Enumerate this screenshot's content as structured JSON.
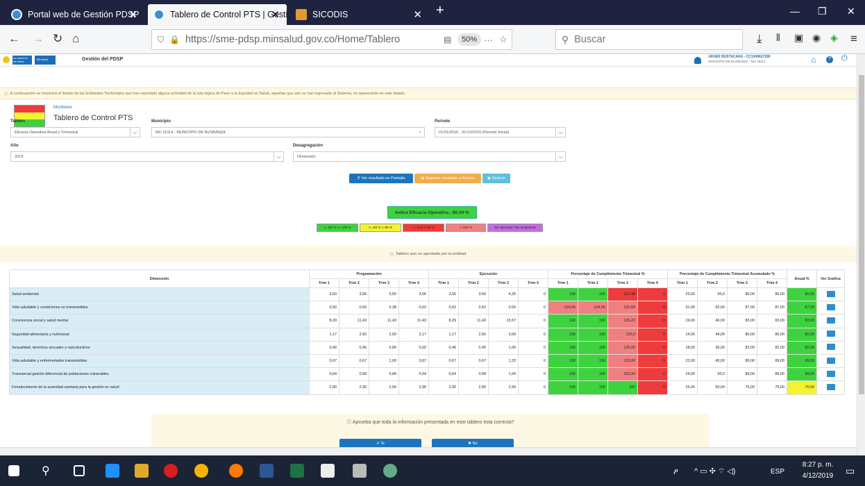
{
  "browser": {
    "tabs": [
      {
        "title": "Portal web de Gestión PDSP"
      },
      {
        "title": "Tablero de Control PTS | Gestió"
      },
      {
        "title": "SICODIS"
      }
    ],
    "url": "https://sme-pdsp.minsalud.gov.co/Home/Tablero",
    "zoom": "50%",
    "search_placeholder": "Buscar"
  },
  "app": {
    "logo_text": "La salud es de todos",
    "logo_badge": "Minsalud",
    "title": "Gestión del PDSP",
    "user": "JAVIER BUSTACARA - CC1049627289",
    "user_sub": "MUNICIPIO DE BUSBANZA - MU 15114",
    "alert": "A continuación se mostrará el listado de las Entidades Territoriales que han reportado alguna actividad de la ruta lógica de Paso a la Equidad en Salud, aquellas que aún no han ingresado al Sistema, no aparecerán en este listado.",
    "breadcrumb": "Monitoreo",
    "page_title": "Tablero de Control PTS"
  },
  "filters": {
    "tablero_label": "Tablero",
    "tablero_value": "Eficacia Operativa Anual y Trimestral",
    "municipio_label": "Municipio",
    "municipio_value": "MU 15114 - MUNICIPIO DE BUSBANZA",
    "periodo_label": "Periodo",
    "periodo_value": "01/01/2016 - 31/12/2019 (Periodo Inicial)",
    "anio_label": "Año",
    "anio_value": "2019",
    "desagregacion_label": "Desagregación",
    "desagregacion_value": "Dimensión"
  },
  "buttons": {
    "ver": "Ver resultado en Pantalla",
    "exportar": "Exportar resultado a Archivo",
    "reducir": "Reducir"
  },
  "indice": "Indice Eficacia Operativa : 80,04 %",
  "legend": [
    {
      "label": ">= 80 % <= 100 %",
      "color": "#3ed33e"
    },
    {
      "label": ">= 60 % < 80 %",
      "color": "#f3f335"
    },
    {
      "label": ">= 0 % < 60 %",
      "color": "#ee3b3b"
    },
    {
      "label": "> 100 %",
      "color": "#f08080"
    },
    {
      "label": "Sin ejecutar / Sin programar",
      "color": "#c36ce0"
    }
  ],
  "notice": "Tablero aun no aprobado por la entidad.",
  "table": {
    "h_dimension": "Dimensión",
    "h_prog": "Programación",
    "h_ejec": "Ejecución",
    "h_pct": "Porcentaje de Cumplimiento Trimestral %",
    "h_acum": "Porcentaje de Cumplimiento Trimestral Acumulado %",
    "h_anual": "Anual %",
    "h_graf": "Ver Grafica",
    "trims": [
      "Trim 1",
      "Trim 2",
      "Trim 3",
      "Trim 4"
    ],
    "rows": [
      {
        "name": "Salud ambiental",
        "prog": [
          "3,50",
          "3,56",
          "3,50",
          "3,56"
        ],
        "ejec": [
          "3,50",
          "3,56",
          "4,25",
          "0"
        ],
        "pct": [
          "100",
          "100",
          "121,43",
          "0"
        ],
        "pc": [
          "g",
          "g",
          "r",
          "r"
        ],
        "acum": [
          "25,00",
          "50,0",
          "80,00",
          "80,00"
        ],
        "anual": "80,00",
        "ac": "g"
      },
      {
        "name": "Vida saludable y condiciones no transmisibles",
        "prog": [
          "0,50",
          "0,50",
          "0,38",
          "0,62"
        ],
        "ejec": [
          "0,62",
          "0,62",
          "0,50",
          "0"
        ],
        "pct": [
          "124,00",
          "124,00",
          "131,58",
          "0"
        ],
        "pc": [
          "p",
          "p",
          "p",
          "r"
        ],
        "acum": [
          "31,00",
          "62,00",
          "87,00",
          "87,00"
        ],
        "anual": "87,00",
        "ac": "g"
      },
      {
        "name": "Convivencia social y salud mental",
        "prog": [
          "8,29",
          "11,43",
          "11,43",
          "11,43"
        ],
        "ejec": [
          "8,29",
          "11,43",
          "15,57",
          "0"
        ],
        "pct": [
          "100",
          "100",
          "136,22",
          "0"
        ],
        "pc": [
          "g",
          "g",
          "p",
          "r"
        ],
        "acum": [
          "19,00",
          "46,00",
          "83,00",
          "83,00"
        ],
        "anual": "83,00",
        "ac": "g"
      },
      {
        "name": "Seguridad alimentaria y nutricional",
        "prog": [
          "1,17",
          "2,50",
          "2,50",
          "2,17"
        ],
        "ejec": [
          "1,17",
          "2,50",
          "3,00",
          "0"
        ],
        "pct": [
          "100",
          "100",
          "120,0",
          "0"
        ],
        "pc": [
          "g",
          "g",
          "p",
          "r"
        ],
        "acum": [
          "14,00",
          "44,00",
          "80,00",
          "80,00"
        ],
        "anual": "80,00",
        "ac": "g"
      },
      {
        "name": "Sexualidad, derechos sexuales y reproductivos",
        "prog": [
          "0,40",
          "0,40",
          "0,80",
          "0,60"
        ],
        "ejec": [
          "0,40",
          "0,40",
          "1,00",
          "0"
        ],
        "pct": [
          "100",
          "100",
          "125,00",
          "0"
        ],
        "pc": [
          "g",
          "g",
          "p",
          "r"
        ],
        "acum": [
          "18,00",
          "36,00",
          "82,00",
          "82,00"
        ],
        "anual": "82,00",
        "ac": "g"
      },
      {
        "name": "Vida saludable y enfermedades transmisibles",
        "prog": [
          "0,67",
          "0,67",
          "1,00",
          "0,67"
        ],
        "ejec": [
          "0,67",
          "0,67",
          "1,33",
          "0"
        ],
        "pct": [
          "100",
          "100",
          "133,00",
          "0"
        ],
        "pc": [
          "g",
          "g",
          "p",
          "r"
        ],
        "acum": [
          "22,00",
          "45,00",
          "89,00",
          "89,00"
        ],
        "anual": "89,00",
        "ac": "g"
      },
      {
        "name": "Transversal gestión diferencial de poblaciones vulnerables",
        "prog": [
          "0,64",
          "0,68",
          "0,68",
          "0,64"
        ],
        "ejec": [
          "0,64",
          "0,68",
          "1,04",
          "0"
        ],
        "pct": [
          "100",
          "100",
          "152,94",
          "0"
        ],
        "pc": [
          "g",
          "g",
          "p",
          "r"
        ],
        "acum": [
          "24,00",
          "50,0",
          "89,00",
          "89,00"
        ],
        "anual": "89,00",
        "ac": "g"
      },
      {
        "name": "Fortalecimiento de la autoridad sanitaria para la gestión en salud",
        "prog": [
          "2,90",
          "2,90",
          "2,90",
          "2,90"
        ],
        "ejec": [
          "2,90",
          "2,90",
          "2,90",
          "0"
        ],
        "pct": [
          "100",
          "100",
          "100",
          "0"
        ],
        "pc": [
          "g",
          "g",
          "g",
          "r"
        ],
        "acum": [
          "25,00",
          "50,00",
          "75,00",
          "75,00"
        ],
        "anual": "75,00",
        "ac": "y"
      }
    ]
  },
  "question": "Aprueba que toda la información presentada en este tablero esta correcta?",
  "yes": "✔ Si",
  "no": "✖ No",
  "taskbar": {
    "lang": "ESP",
    "time": "8:27 p. m.",
    "date": "4/12/2019"
  }
}
